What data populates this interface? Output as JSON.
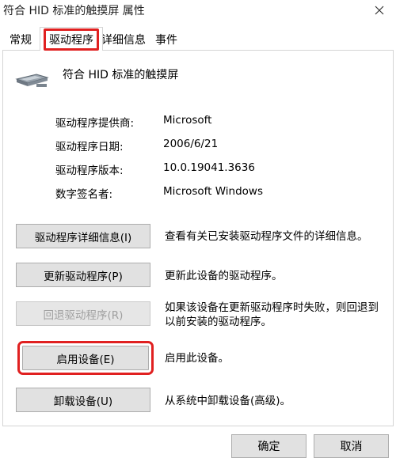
{
  "window": {
    "title": "符合 HID 标准的触摸屏 属性"
  },
  "tabs": [
    {
      "label": "常规"
    },
    {
      "label": "驱动程序"
    },
    {
      "label": "详细信息"
    },
    {
      "label": "事件"
    }
  ],
  "device": {
    "name": "符合 HID 标准的触摸屏",
    "icon": "touchscreen-device-icon"
  },
  "info": [
    {
      "label": "驱动程序提供商:",
      "value": "Microsoft"
    },
    {
      "label": "驱动程序日期:",
      "value": "2006/6/21"
    },
    {
      "label": "驱动程序版本:",
      "value": "10.0.19041.3636"
    },
    {
      "label": "数字签名者:",
      "value": "Microsoft Windows"
    }
  ],
  "actions": [
    {
      "button": "驱动程序详细信息(I)",
      "description": "查看有关已安装驱动程序文件的详细信息。"
    },
    {
      "button": "更新驱动程序(P)",
      "description": "更新此设备的驱动程序。"
    },
    {
      "button": "回退驱动程序(R)",
      "description": "如果该设备在更新驱动程序时失败，则回退到以前安装的驱动程序。"
    },
    {
      "button": "启用设备(E)",
      "description": "启用此设备。"
    },
    {
      "button": "卸载设备(U)",
      "description": "从系统中卸载设备(高级)。"
    }
  ],
  "footer": {
    "ok": "确定",
    "cancel": "取消"
  },
  "colors": {
    "highlight": "#e02020",
    "button_bg": "#e1e1e1",
    "disabled_text": "#a0a0a0"
  }
}
